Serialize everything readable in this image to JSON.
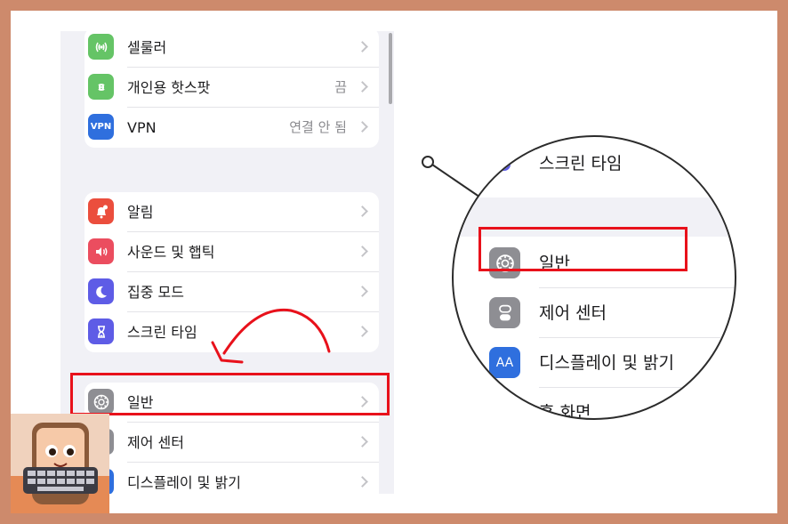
{
  "settings": {
    "group1": [
      {
        "icon": "cellular-icon",
        "color": "#65c466",
        "label": "셀룰러",
        "detail": ""
      },
      {
        "icon": "hotspot-icon",
        "color": "#65c466",
        "label": "개인용 핫스팟",
        "detail": "끔"
      },
      {
        "icon": "vpn-icon",
        "color": "#2f6fde",
        "label": "VPN",
        "detail": "연결 안 됨",
        "icon_text": "VPN"
      }
    ],
    "group2": [
      {
        "icon": "notifications-icon",
        "color": "#eb4e3d",
        "label": "알림"
      },
      {
        "icon": "sound-icon",
        "color": "#eb4d5f",
        "label": "사운드 및 햅틱"
      },
      {
        "icon": "focus-moon-icon",
        "color": "#5e5ce6",
        "label": "집중 모드"
      },
      {
        "icon": "hourglass-icon",
        "color": "#5e5ce6",
        "label": "스크린 타임"
      }
    ],
    "group3": [
      {
        "icon": "gear-icon",
        "color": "#8e8e93",
        "label": "일반"
      },
      {
        "icon": "control-center-icon",
        "color": "#8e8e93",
        "label": "제어 센터"
      },
      {
        "icon": "display-icon",
        "color": "#2f6fde",
        "label": "디스플레이 및 밝기"
      }
    ]
  },
  "magnifier": {
    "rows": [
      {
        "label": "스크린 타임"
      },
      {
        "label": "일반"
      },
      {
        "label": "제어 센터"
      },
      {
        "label": "디스플레이 및 밝기",
        "icon_text": "AA"
      },
      {
        "label": "홈 화면"
      }
    ]
  },
  "colors": {
    "frame": "#cd8a6c",
    "highlight": "#e8111b",
    "arrow": "#e8111b"
  }
}
